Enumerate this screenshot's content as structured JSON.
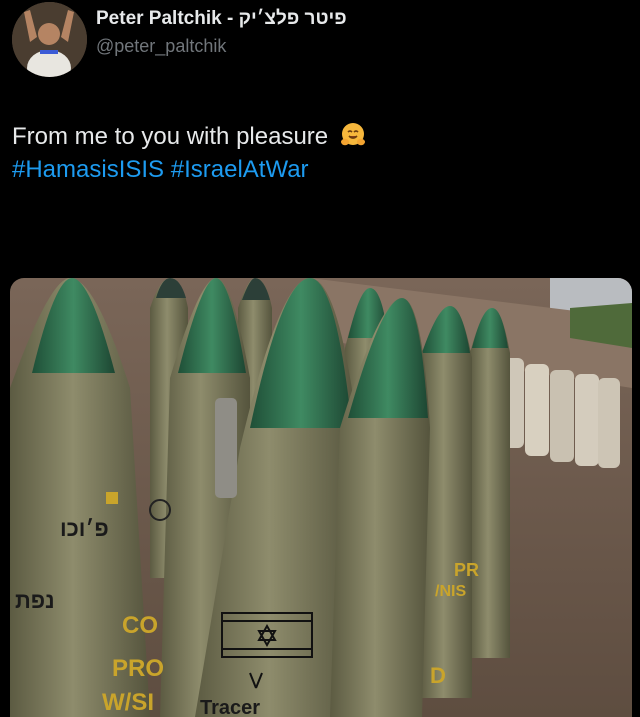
{
  "header": {
    "display_name": "Peter Paltchik - פיטר פלצ׳יק",
    "handle": "@peter_paltchik"
  },
  "tweet": {
    "text": "From me to you with pleasure",
    "emoji": "hugging-face-emoji",
    "hashtags": [
      "#HamasisISIS",
      "#IsraelAtWar"
    ]
  },
  "media": {
    "shell_markings": [
      "פ׳וכו",
      "נפת",
      "CO",
      "PRO",
      "W/SI",
      "PR",
      "/NIS",
      "D",
      "Tracer"
    ],
    "colors": {
      "shell_body": "#7c7a5d",
      "shell_tip": "#2f6a4c",
      "ground": "#6e5a4a",
      "sky": "#b9bcc0"
    }
  },
  "colors": {
    "background": "#000000",
    "text": "#e7e9ea",
    "secondary_text": "#71767b",
    "link": "#1d9bf0"
  }
}
